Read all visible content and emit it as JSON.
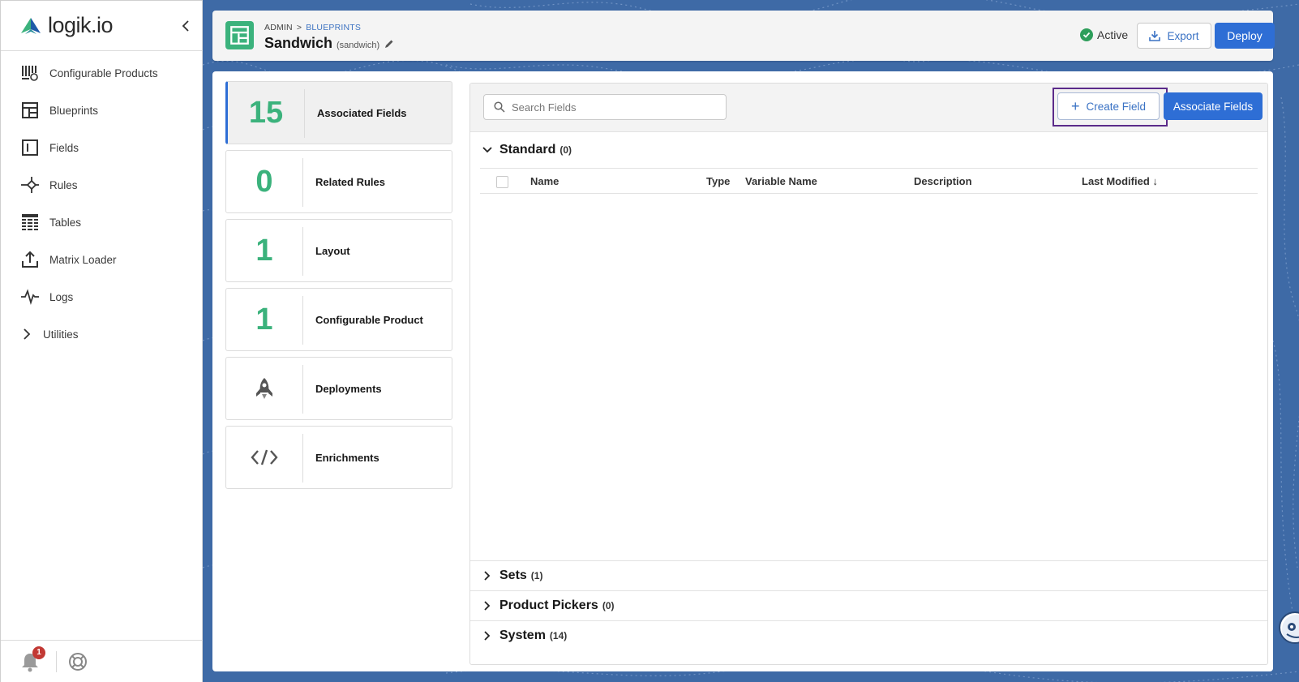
{
  "app": {
    "logo_text": "logik.io"
  },
  "sidebar": {
    "items": [
      {
        "label": "Configurable Products",
        "icon": "configurable-products-icon"
      },
      {
        "label": "Blueprints",
        "icon": "blueprint-icon"
      },
      {
        "label": "Fields",
        "icon": "fields-icon"
      },
      {
        "label": "Rules",
        "icon": "rules-icon"
      },
      {
        "label": "Tables",
        "icon": "tables-icon"
      },
      {
        "label": "Matrix Loader",
        "icon": "upload-icon"
      },
      {
        "label": "Logs",
        "icon": "pulse-icon"
      },
      {
        "label": "Utilities",
        "icon": "chevron-right-icon"
      }
    ],
    "notification_count": "1"
  },
  "header": {
    "breadcrumb": {
      "root": "ADMIN",
      "separator": ">",
      "link": "BLUEPRINTS"
    },
    "title": "Sandwich",
    "subtitle": "(sandwich)",
    "status": "Active",
    "export_label": "Export",
    "deploy_label": "Deploy"
  },
  "cards": [
    {
      "value": "15",
      "label": "Associated Fields",
      "active": true
    },
    {
      "value": "0",
      "label": "Related Rules"
    },
    {
      "value": "1",
      "label": "Layout"
    },
    {
      "value": "1",
      "label": "Configurable Product"
    },
    {
      "value": "",
      "label": "Deployments",
      "icon": "rocket-icon"
    },
    {
      "value": "",
      "label": "Enrichments",
      "icon": "code-icon"
    }
  ],
  "fields": {
    "search_placeholder": "Search Fields",
    "create_label": "Create Field",
    "associate_label": "Associate Fields",
    "sections": [
      {
        "name": "Standard",
        "count": "(0)",
        "expanded": true
      },
      {
        "name": "Sets",
        "count": "(1)"
      },
      {
        "name": "Product Pickers",
        "count": "(0)"
      },
      {
        "name": "System",
        "count": "(14)"
      }
    ],
    "columns": [
      "Name",
      "Type",
      "Variable Name",
      "Description",
      "Last Modified ↓"
    ]
  },
  "colors": {
    "accent": "#2e6ed5",
    "brand_green": "#3bb27c",
    "background_blue": "#3e6aa6",
    "highlight": "#5b2b8a"
  }
}
